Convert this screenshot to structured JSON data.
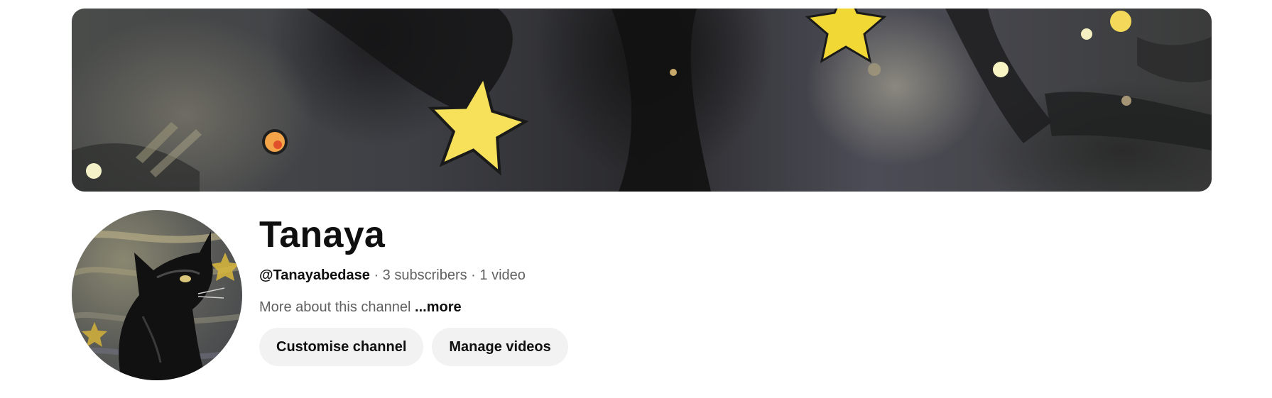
{
  "channel": {
    "name": "Tanaya",
    "handle": "@Tanayabedase",
    "separator": "·",
    "subscribers": "3 subscribers",
    "videos": "1 video",
    "about_text": "More about this channel",
    "more_label": "...more"
  },
  "actions": {
    "customise_label": "Customise channel",
    "manage_label": "Manage videos"
  },
  "colors": {
    "star_yellow": "#f7e15a",
    "text_primary": "#0f0f0f",
    "text_secondary": "#606060",
    "button_bg": "#f2f2f2"
  }
}
